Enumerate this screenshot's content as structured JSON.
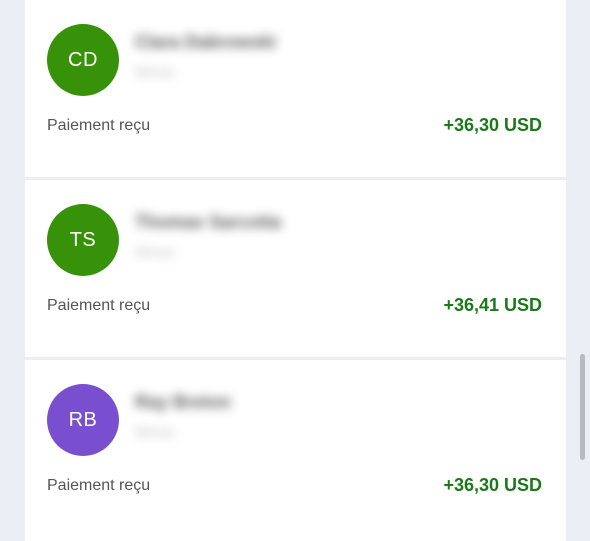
{
  "transactions": [
    {
      "initials": "CD",
      "avatar_color": "#37920a",
      "name": "Clara Dabrowski",
      "subtitle": "Minas",
      "label": "Paiement reçu",
      "amount": "+36,30 USD"
    },
    {
      "initials": "TS",
      "avatar_color": "#37920a",
      "name": "Thomas Sarcotta",
      "subtitle": "Minas",
      "label": "Paiement reçu",
      "amount": "+36,41 USD"
    },
    {
      "initials": "RB",
      "avatar_color": "#7a4fcf",
      "name": "Ray Breton",
      "subtitle": "Minas",
      "label": "Paiement reçu",
      "amount": "+36,30 USD"
    }
  ],
  "colors": {
    "background": "#eceef6",
    "card": "#ffffff",
    "amount_positive": "#1a7a1a"
  }
}
